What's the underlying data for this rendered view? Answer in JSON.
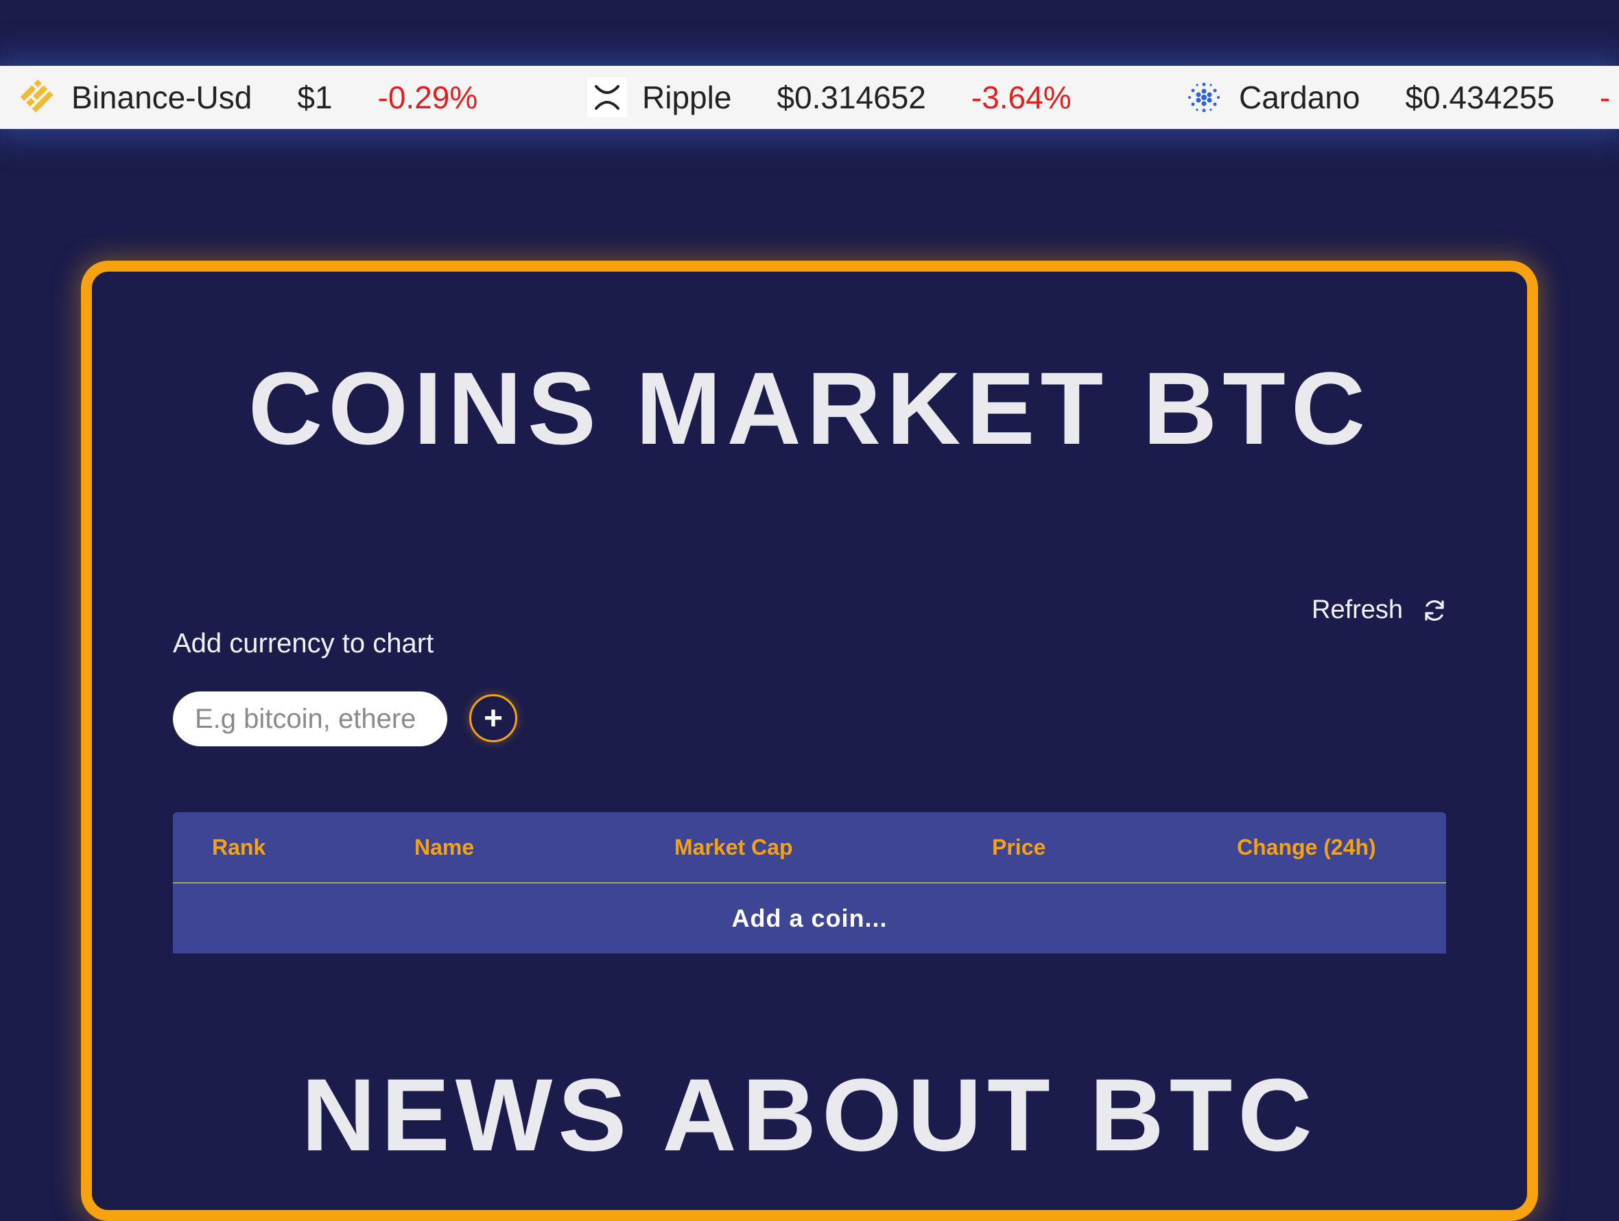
{
  "ticker": {
    "items": [
      {
        "name": "Binance-Usd",
        "price": "$1",
        "change": "-0.29%",
        "icon": "binance-usd-logo-icon"
      },
      {
        "name": "Ripple",
        "price": "$0.314652",
        "change": "-3.64%",
        "icon": "ripple-x-logo-icon"
      },
      {
        "name": "Cardano",
        "price": "$0.434255",
        "change": "-",
        "icon": "cardano-logo-icon"
      }
    ]
  },
  "main": {
    "title": "COINS MARKET BTC",
    "refresh_label": "Refresh",
    "refresh_icon": "refresh-icon",
    "add_label": "Add currency to chart",
    "search_placeholder": "E.g bitcoin, ethere",
    "add_button_label": "+",
    "table": {
      "columns": [
        "Rank",
        "Name",
        "Market Cap",
        "Price",
        "Change (24h)"
      ],
      "empty_message": "Add a coin..."
    },
    "news_title": "NEWS ABOUT BTC"
  },
  "colors": {
    "background": "#1b1c4b",
    "accent": "#f7a20f",
    "table": "#3e4594",
    "negative": "#e0201f"
  }
}
